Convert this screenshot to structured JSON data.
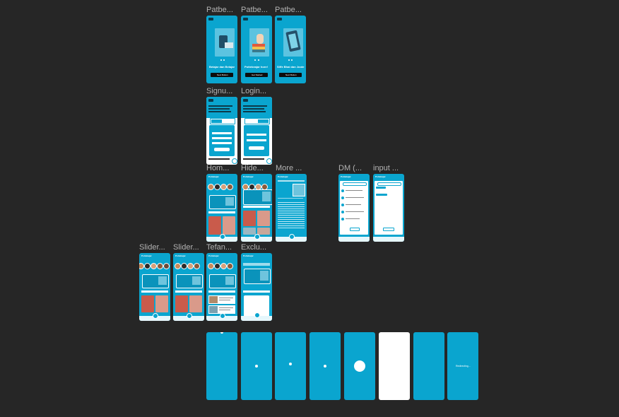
{
  "frames": {
    "onboarding_1": {
      "label": "Patbe...",
      "caption": "Belajar dan Belajar",
      "button": "Next Button"
    },
    "onboarding_2": {
      "label": "Patbe...",
      "caption": "Pottebeajar hore!",
      "button": "Get Started"
    },
    "onboarding_3": {
      "label": "Patbe...",
      "caption": "Siffe Bhai dan Joote",
      "button": "Next Button"
    },
    "signup": {
      "label": "Signu..."
    },
    "login": {
      "label": "Login..."
    },
    "home": {
      "label": "Hom..."
    },
    "hide": {
      "label": "Hide..."
    },
    "more": {
      "label": "More ..."
    },
    "dm": {
      "label": "DM (..."
    },
    "input": {
      "label": "input ..."
    },
    "slider_1": {
      "label": "Slider..."
    },
    "slider_2": {
      "label": "Slider..."
    },
    "tefan": {
      "label": "Tefan..."
    },
    "exclu": {
      "label": "Exclu..."
    },
    "splash_8": {
      "text": "Redirecting..."
    }
  },
  "app_name": "Pottebajar",
  "colors": {
    "canvas": "#262626",
    "frame": "#0aa5cf",
    "label": "#b3b3b3"
  }
}
